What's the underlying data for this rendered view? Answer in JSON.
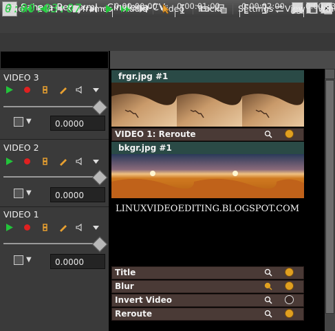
{
  "window": {
    "title": "Sahara-Rero.xml - Cinelerra-CV",
    "controls": [
      "_",
      "▫",
      "✕"
    ]
  },
  "menu": [
    "File",
    "Edit",
    "Keyframes",
    "Audio",
    "Video",
    "Tracks",
    "Settings",
    "View",
    "Wind"
  ],
  "clock": "0:00:03:07",
  "ruler": {
    "ticks": [
      "0:00:00:00",
      "0:00:01:00",
      "0:00:02:00",
      "0:00:03"
    ]
  },
  "tracks": [
    {
      "title": "VIDEO 3",
      "fade": "0.0000"
    },
    {
      "title": "VIDEO 2",
      "fade": "0.0000"
    },
    {
      "title": "VIDEO 1",
      "fade": "0.0000"
    }
  ],
  "edits": {
    "top_label": "frgr.jpg #1",
    "reroute_label": "VIDEO 1: Reroute",
    "mid_label": "bkgr.jpg #1"
  },
  "watermark": "LINUXVIDEOEDITING.BLOGSPOT.COM",
  "plugins": [
    {
      "name": "Title",
      "on": true
    },
    {
      "name": "Blur",
      "on": true
    },
    {
      "name": "Invert Video",
      "on": false
    },
    {
      "name": "Reroute",
      "on": true
    }
  ],
  "colors": {
    "clock": "#2dd24a",
    "edit_label_bg": "#2a4a46",
    "plugin_bg": "#4a3a36",
    "play_green": "#22c43a",
    "record_red": "#e02020",
    "plugin_on": "#e0a020"
  }
}
